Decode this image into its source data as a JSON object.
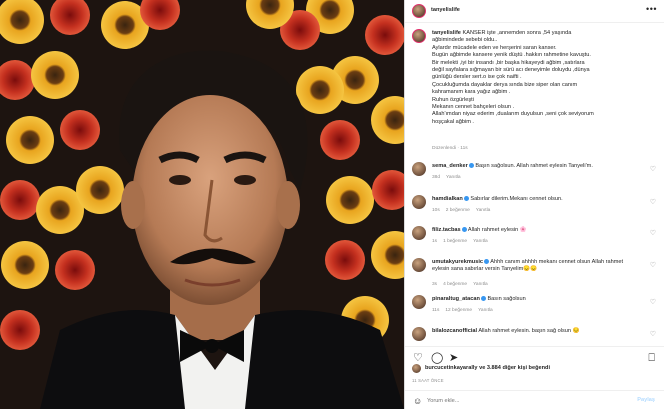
{
  "post": {
    "username": "tanyelislife",
    "more_icon": "more-horizontal-icon",
    "caption_user": "tanyelislife",
    "caption_lines": [
      "KANSER işte ,annemden sonra ,54 yaşında",
      "ağbimindede sebebi oldu..",
      "Aylardır mücadele eden ve herşerini saran kanser.",
      "Bugün ağbimde kansere yenik düştü .hakkın rahmetine kavuştu.",
      "Bir melekti ,iyi bir insandı ,bir başka hikayeydi ağbim ,satırlara",
      "değil sayfalara sığmayan bir sürü acı deneyimle doluydu ,dünya",
      "günlüğü dersler sert.o ise çok naifti .",
      "Çocukluğumda dayaklar derya sında bize siper olan canım",
      "kahramanım kara yağız ağbim .",
      "Ruhun özgürleşti",
      "Mekanın cennet bahçeleri olsun .",
      "Allah'ımdan niyaz ederim ,dualarım duyulsun ,seni çok seviyorum",
      "hoşçakal ağbim ."
    ],
    "caption_meta": "Düzenlendi · 11s"
  },
  "comments": [
    {
      "user": "sema_denker",
      "verified": true,
      "text": "Başın sağolsun. Allah rahmet eylesin Tanyeli'm.",
      "meta": [
        "38d",
        "Yanıtla"
      ]
    },
    {
      "user": "hamdialkan",
      "verified": true,
      "text": "Sabırlar dilerim.Mekanı cennet olsun.",
      "meta": [
        "10s",
        "2 beğenme",
        "Yanıtla"
      ]
    },
    {
      "user": "filiz.tacbas",
      "verified": true,
      "text": "Allah rahmet eylesin 🌸",
      "meta": [
        "1s",
        "1 beğenme",
        "Yanıtla"
      ]
    },
    {
      "user": "umutakyurekmusic",
      "verified": true,
      "text": "Ahhh canım ahhhh mekanı cennet olsun Allah rahmet eylesin sana sabırlar versin Tanyelim😞😞",
      "meta": [
        "3s",
        "4 beğenme",
        "Yanıtla"
      ]
    },
    {
      "user": "pinaraltug_atacan",
      "verified": true,
      "text": "Basın sağolsun",
      "meta": [
        "11s",
        "12 beğenme",
        "Yanıtla"
      ]
    },
    {
      "user": "bilalozcanofficial",
      "verified": false,
      "text": "Allah rahmet eylesin. başın sağ olsun 😔",
      "meta": []
    }
  ],
  "likes": {
    "user": "burcucetinkayarally",
    "count_text": "ve 3.884 diğer kişi beğendi"
  },
  "date": "11 SAAT ÖNCE",
  "composer": {
    "placeholder": "Yorum ekle...",
    "post_label": "Paylaş",
    "emoji_icon": "smile-icon"
  }
}
